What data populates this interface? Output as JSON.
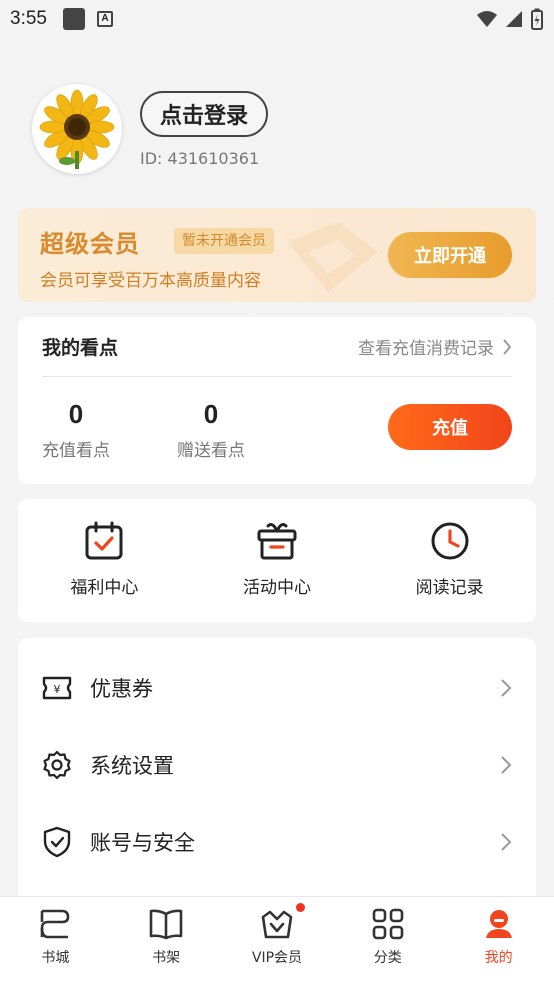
{
  "status_bar": {
    "time": "3:55"
  },
  "profile": {
    "login_label": "点击登录",
    "user_id": "ID: 431610361"
  },
  "vip": {
    "title": "超级会员",
    "badge": "暂未开通会员",
    "description": "会员可享受百万本高质量内容",
    "open_button": "立即开通"
  },
  "points": {
    "title": "我的看点",
    "records_link": "查看充值消费记录",
    "recharge_points": {
      "value": "0",
      "label": "充值看点"
    },
    "gift_points": {
      "value": "0",
      "label": "赠送看点"
    },
    "recharge_button": "充值"
  },
  "quick_actions": [
    {
      "label": "福利中心",
      "icon": "calendar-check-icon"
    },
    {
      "label": "活动中心",
      "icon": "gift-box-icon"
    },
    {
      "label": "阅读记录",
      "icon": "clock-icon"
    }
  ],
  "menu": [
    {
      "label": "优惠券",
      "icon": "coupon-icon"
    },
    {
      "label": "系统设置",
      "icon": "gear-icon"
    },
    {
      "label": "账号与安全",
      "icon": "shield-check-icon"
    }
  ],
  "tabs": [
    {
      "label": "书城",
      "icon": "bookstore-icon"
    },
    {
      "label": "书架",
      "icon": "bookshelf-icon"
    },
    {
      "label": "VIP会员",
      "icon": "vip-crown-icon"
    },
    {
      "label": "分类",
      "icon": "category-grid-icon"
    },
    {
      "label": "我的",
      "icon": "profile-icon"
    }
  ],
  "colors": {
    "accent": "#f0451e",
    "vip_gold": "#d98a2c",
    "vip_bg": "#fbe8d2"
  }
}
